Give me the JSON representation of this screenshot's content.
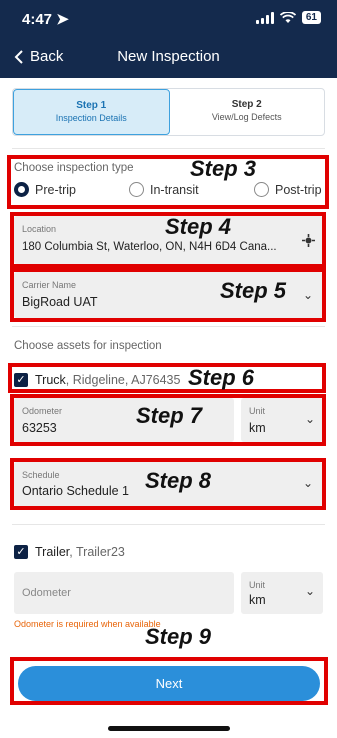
{
  "status_bar": {
    "time": "4:47",
    "battery": "61"
  },
  "nav": {
    "back_label": "Back",
    "title": "New Inspection"
  },
  "stepper": {
    "steps": [
      {
        "title": "Step 1",
        "subtitle": "Inspection Details",
        "active": true
      },
      {
        "title": "Step 2",
        "subtitle": "View/Log Defects",
        "active": false
      }
    ]
  },
  "inspection_type": {
    "label": "Choose inspection type",
    "options": [
      "Pre-trip",
      "In-transit",
      "Post-trip"
    ],
    "selected": "Pre-trip"
  },
  "location": {
    "label": "Location",
    "value": "180 Columbia St, Waterloo, ON, N4H 6D4 Cana..."
  },
  "carrier": {
    "label": "Carrier Name",
    "value": "BigRoad UAT"
  },
  "assets": {
    "label": "Choose assets for inspection"
  },
  "truck": {
    "name": "Truck",
    "detail": ", Ridgeline, AJ76435",
    "checked": true,
    "odometer": {
      "label": "Odometer",
      "value": "63253"
    },
    "unit": {
      "label": "Unit",
      "value": "km"
    },
    "schedule": {
      "label": "Schedule",
      "value": "Ontario Schedule 1"
    }
  },
  "trailer": {
    "name": "Trailer",
    "detail": ", Trailer23",
    "checked": true,
    "odometer": {
      "placeholder": "Odometer"
    },
    "unit": {
      "label": "Unit",
      "value": "km"
    },
    "error": "Odometer is required when available"
  },
  "next_label": "Next",
  "annotations": {
    "step3": "Step 3",
    "step4": "Step 4",
    "step5": "Step 5",
    "step6": "Step 6",
    "step7": "Step 7",
    "step8": "Step 8",
    "step9": "Step 9"
  },
  "colors": {
    "header": "#142a4d",
    "accent": "#2b8fda",
    "annotation_border": "#e00000",
    "error": "#e8650a"
  },
  "icons": [
    "location-arrow-icon",
    "signal-icon",
    "wifi-icon",
    "battery-icon",
    "chevron-left-icon",
    "crosshair-icon",
    "chevron-down-icon",
    "checkbox-icon"
  ]
}
